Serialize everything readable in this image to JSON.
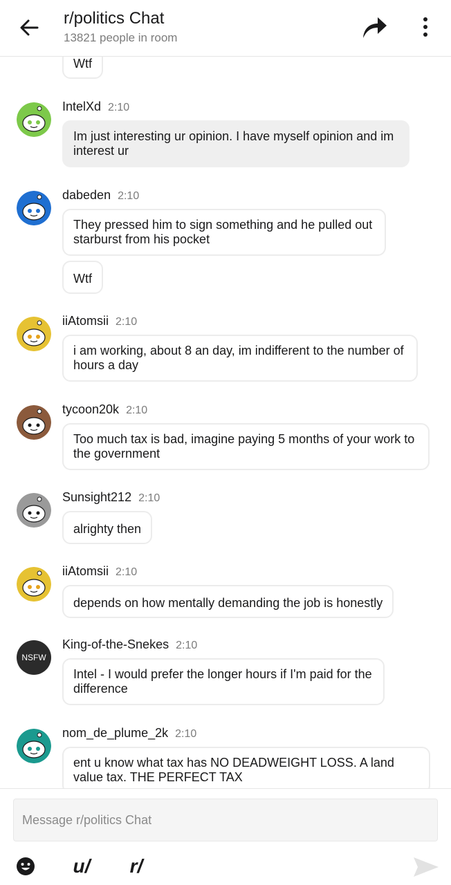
{
  "header": {
    "title": "r/politics Chat",
    "subtitle": "13821 people in room"
  },
  "colors": {
    "border": "#ececec",
    "highlight_bubble": "#efefef",
    "muted_text": "#7c7c7c"
  },
  "messages": [
    {
      "user": "",
      "time": "",
      "avatar": "none",
      "bubbles": [
        "Wtf"
      ]
    },
    {
      "user": "IntelXd",
      "time": "2:10",
      "avatar": "snoo-green",
      "bubbles": [
        "Im just interesting ur opinion. I have myself opinion and im interest ur"
      ]
    },
    {
      "user": "dabeden",
      "time": "2:10",
      "avatar": "snoo-blue",
      "bubbles": [
        "They pressed him to sign something and he pulled out starburst from his pocket",
        "Wtf"
      ]
    },
    {
      "user": "iiAtomsii",
      "time": "2:10",
      "avatar": "snoo-yellow",
      "bubbles": [
        "i am working, about 8 an day, im indifferent to the number of hours a day"
      ]
    },
    {
      "user": "tycoon20k",
      "time": "2:10",
      "avatar": "snoo-brown",
      "bubbles": [
        "Too much tax is bad, imagine paying 5 months of your work to the government"
      ]
    },
    {
      "user": "Sunsight212",
      "time": "2:10",
      "avatar": "snoo-grey",
      "bubbles": [
        "alrighty then"
      ]
    },
    {
      "user": "iiAtomsii",
      "time": "2:10",
      "avatar": "snoo-yellow",
      "bubbles": [
        "depends on how mentally demanding the job is honestly"
      ]
    },
    {
      "user": "King-of-the-Snekes",
      "time": "2:10",
      "avatar": "nsfw",
      "avatar_label": "NSFW",
      "bubbles": [
        "Intel - I would prefer the longer hours if I'm paid for the difference"
      ]
    },
    {
      "user": "nom_de_plume_2k",
      "time": "2:10",
      "avatar": "snoo-teal",
      "bubbles": [
        "ent u know what tax has NO DEADWEIGHT LOSS. A land value tax. THE PERFECT TAX"
      ]
    }
  ],
  "composer": {
    "placeholder": "Message r/politics Chat",
    "user_mention": "u/",
    "subreddit_mention": "r/"
  }
}
